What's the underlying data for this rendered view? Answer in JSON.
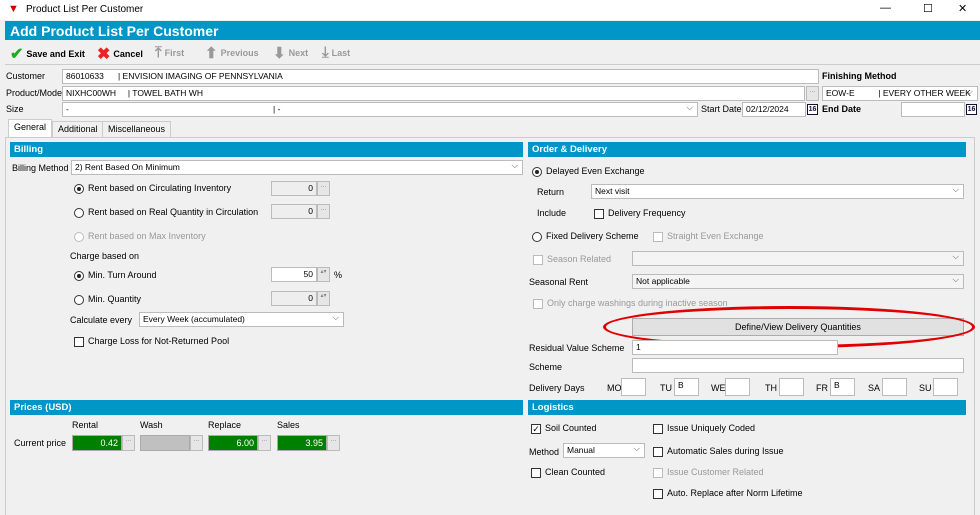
{
  "window": {
    "title": "Product List Per Customer",
    "min": "—",
    "max": "☐",
    "close": "✕"
  },
  "header": {
    "title": "Add Product List Per Customer"
  },
  "toolbar": {
    "save": "Save and Exit",
    "cancel": "Cancel",
    "first": "First",
    "previous": "Previous",
    "next": "Next",
    "last": "Last"
  },
  "fields": {
    "customer_label": "Customer",
    "customer": "86010633      | ENVISION IMAGING OF PENNSYLVANIA",
    "product_label": "Product/Model",
    "product": "NIXHC00WH     | TOWEL BATH WH",
    "size_label": "Size",
    "size_left": "-",
    "size_right": "| -",
    "finishing_label": "Finishing Method",
    "finishing": "EOW-E          | EVERY OTHER WEEK",
    "start_label": "Start Date",
    "start": "02/12/2024",
    "end_label": "End Date",
    "end": "",
    "cal": "16",
    "ellipsis": "..."
  },
  "tabs": [
    "General",
    "Additional",
    "Miscellaneous"
  ],
  "billing": {
    "title": "Billing",
    "method_label": "Billing Method",
    "method": "2) Rent Based On Minimum",
    "r1": "Rent based on Circulating Inventory",
    "r1v": "0",
    "r2": "Rent based on Real Quantity in Circulation",
    "r2v": "0",
    "r3": "Rent based on Max Inventory",
    "charge_label": "Charge based on",
    "c1": "Min. Turn Around",
    "c1v": "50",
    "pct": "%",
    "c2": "Min. Quantity",
    "c2v": "0",
    "calc_label": "Calculate every",
    "calc": "Every Week (accumulated)",
    "loss": "Charge Loss for Not-Returned Pool"
  },
  "order": {
    "title": "Order & Delivery",
    "delayed": "Delayed Even Exchange",
    "return_label": "Return",
    "return": "Next visit",
    "include_label": "Include",
    "delivery_freq": "Delivery Frequency",
    "fixed": "Fixed Delivery Scheme",
    "straight": "Straight Even Exchange",
    "season": "Season Related",
    "seasonal_label": "Seasonal Rent",
    "seasonal": "Not applicable",
    "only_charge": "Only charge washings during inactive season",
    "define_btn": "Define/View Delivery Quantities",
    "residual_label": "Residual Value Scheme",
    "residual": "1",
    "scheme_label": "Scheme",
    "days_label": "Delivery Days",
    "days": [
      {
        "d": "MO",
        "v": ""
      },
      {
        "d": "TU",
        "v": "B"
      },
      {
        "d": "WE",
        "v": ""
      },
      {
        "d": "TH",
        "v": ""
      },
      {
        "d": "FR",
        "v": "B"
      },
      {
        "d": "SA",
        "v": ""
      },
      {
        "d": "SU",
        "v": ""
      }
    ]
  },
  "prices": {
    "title": "Prices (USD)",
    "row_label": "Current price",
    "cols": [
      {
        "h": "Rental",
        "v": "0.42"
      },
      {
        "h": "Wash",
        "v": ""
      },
      {
        "h": "Replace",
        "v": "6.00"
      },
      {
        "h": "Sales",
        "v": "3.95"
      }
    ]
  },
  "logistics": {
    "title": "Logistics",
    "soil": "Soil Counted",
    "method_label": "Method",
    "method": "Manual",
    "clean": "Clean Counted",
    "unique": "Issue Uniquely Coded",
    "auto_sales": "Automatic Sales during Issue",
    "cust_rel": "Issue Customer Related",
    "auto_replace": "Auto. Replace after Norm Lifetime"
  },
  "colors": {
    "accent": "#0096c8",
    "price_green": "#008000",
    "highlight": "#e00000"
  }
}
